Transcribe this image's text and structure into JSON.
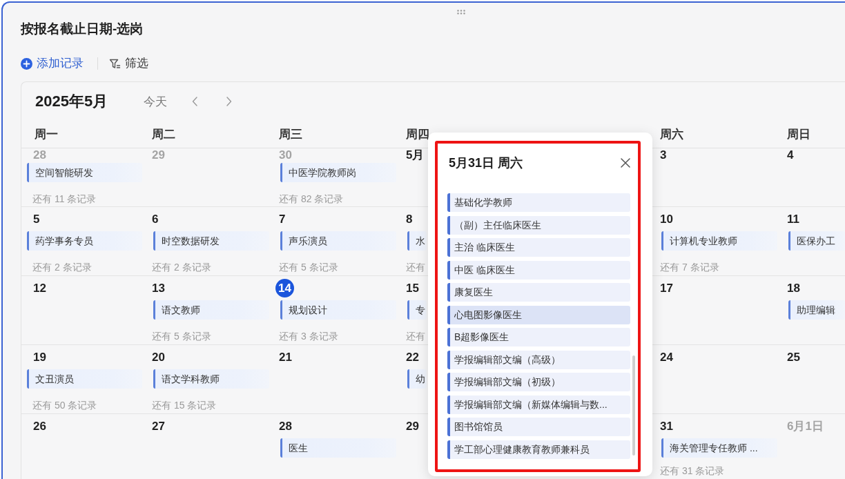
{
  "board": {
    "title": "按报名截止日期-选岗"
  },
  "toolbar": {
    "add_label": "添加记录",
    "filter_label": "筛选"
  },
  "calendar": {
    "month": "2025年5月",
    "today_label": "今天",
    "weekdays": [
      {
        "kind": "label",
        "label": "周一"
      },
      {
        "kind": "label",
        "label": "周二"
      },
      {
        "kind": "label",
        "label": "周三"
      },
      {
        "kind": "label",
        "label": "周四"
      },
      {
        "kind": "covered"
      },
      {
        "kind": "label",
        "label": "周六"
      },
      {
        "kind": "label",
        "label": "周日"
      }
    ],
    "weeks": [
      {
        "days": [
          {
            "kind": "day",
            "date": "28",
            "muted": true,
            "today": false,
            "events": [
              "空间智能研发"
            ],
            "more": "还有 11 条记录"
          },
          {
            "kind": "day",
            "date": "29",
            "muted": true,
            "today": false
          },
          {
            "kind": "day",
            "date": "30",
            "muted": true,
            "today": false,
            "events": [
              "中医学院教师岗"
            ],
            "more": "还有 82 条记录"
          },
          {
            "kind": "day",
            "date": "5月",
            "muted": false,
            "today": false
          },
          {
            "kind": "covered"
          },
          {
            "kind": "day",
            "date": "3",
            "muted": false,
            "today": false
          },
          {
            "kind": "day",
            "date": "4",
            "muted": false,
            "today": false
          }
        ]
      },
      {
        "days": [
          {
            "kind": "day",
            "date": "5",
            "muted": false,
            "today": false,
            "events": [
              "药学事务专员"
            ],
            "more": "还有 2 条记录"
          },
          {
            "kind": "day",
            "date": "6",
            "muted": false,
            "today": false,
            "events": [
              "时空数据研发"
            ],
            "more": "还有 2 条记录"
          },
          {
            "kind": "day",
            "date": "7",
            "muted": false,
            "today": false,
            "events": [
              "声乐演员"
            ],
            "more": "还有 5 条记录"
          },
          {
            "kind": "day",
            "date": "8",
            "muted": false,
            "today": false,
            "events": [
              "水"
            ],
            "more": "还有"
          },
          {
            "kind": "covered"
          },
          {
            "kind": "day",
            "date": "10",
            "muted": false,
            "today": false,
            "events": [
              "计算机专业教师"
            ],
            "more": "还有 7 条记录"
          },
          {
            "kind": "day",
            "date": "11",
            "muted": false,
            "today": false,
            "events": [
              "医保办工"
            ]
          }
        ]
      },
      {
        "days": [
          {
            "kind": "day",
            "date": "12",
            "muted": false,
            "today": false
          },
          {
            "kind": "day",
            "date": "13",
            "muted": false,
            "today": false,
            "events": [
              "语文教师"
            ],
            "more": "还有 5 条记录"
          },
          {
            "kind": "day",
            "date": "14",
            "muted": false,
            "today": true,
            "events": [
              "规划设计"
            ],
            "more": "还有 3 条记录"
          },
          {
            "kind": "day",
            "date": "15",
            "muted": false,
            "today": false,
            "events": [
              "专"
            ],
            "more": "还有"
          },
          {
            "kind": "covered"
          },
          {
            "kind": "day",
            "date": "17",
            "muted": false,
            "today": false
          },
          {
            "kind": "day",
            "date": "18",
            "muted": false,
            "today": false,
            "events": [
              "助理编辑"
            ]
          }
        ]
      },
      {
        "days": [
          {
            "kind": "day",
            "date": "19",
            "muted": false,
            "today": false,
            "events": [
              "文丑演员"
            ],
            "more": "还有 50 条记录"
          },
          {
            "kind": "day",
            "date": "20",
            "muted": false,
            "today": false,
            "events": [
              "语文学科教师"
            ],
            "more": "还有 15 条记录"
          },
          {
            "kind": "day",
            "date": "21",
            "muted": false,
            "today": false
          },
          {
            "kind": "day",
            "date": "22",
            "muted": false,
            "today": false,
            "events": [
              "幼"
            ]
          },
          {
            "kind": "covered"
          },
          {
            "kind": "day",
            "date": "24",
            "muted": false,
            "today": false
          },
          {
            "kind": "day",
            "date": "25",
            "muted": false,
            "today": false
          }
        ]
      },
      {
        "days": [
          {
            "kind": "day",
            "date": "26",
            "muted": false,
            "today": false
          },
          {
            "kind": "day",
            "date": "27",
            "muted": false,
            "today": false
          },
          {
            "kind": "day",
            "date": "28",
            "muted": false,
            "today": false,
            "events": [
              "医生"
            ]
          },
          {
            "kind": "day",
            "date": "29",
            "muted": false,
            "today": false
          },
          {
            "kind": "covered"
          },
          {
            "kind": "day",
            "date": "31",
            "muted": false,
            "today": false,
            "events": [
              "海关管理专任教师 ..."
            ],
            "more": "还有 31 条记录"
          },
          {
            "kind": "day",
            "date": "6月1日",
            "muted": true,
            "today": false
          }
        ]
      }
    ]
  },
  "popup": {
    "title": "5月31日 周六",
    "annotation": {
      "kind": "outline"
    },
    "items": [
      {
        "label": "基础化学教师",
        "highlighted": false
      },
      {
        "label": "（副）主任临床医生",
        "highlighted": false
      },
      {
        "label": "主治 临床医生",
        "highlighted": false
      },
      {
        "label": "中医 临床医生",
        "highlighted": false
      },
      {
        "label": "康复医生",
        "highlighted": false
      },
      {
        "label": "心电图影像医生",
        "highlighted": true
      },
      {
        "label": "B超影像医生",
        "highlighted": false
      },
      {
        "label": "学报编辑部文编（高级）",
        "highlighted": false
      },
      {
        "label": "学报编辑部文编（初级）",
        "highlighted": false
      },
      {
        "label": "学报编辑部文编（新媒体编辑与数...",
        "highlighted": false
      },
      {
        "label": "图书馆馆员",
        "highlighted": false
      },
      {
        "label": "学工部心理健康教育教师兼科员",
        "highlighted": false
      }
    ]
  }
}
